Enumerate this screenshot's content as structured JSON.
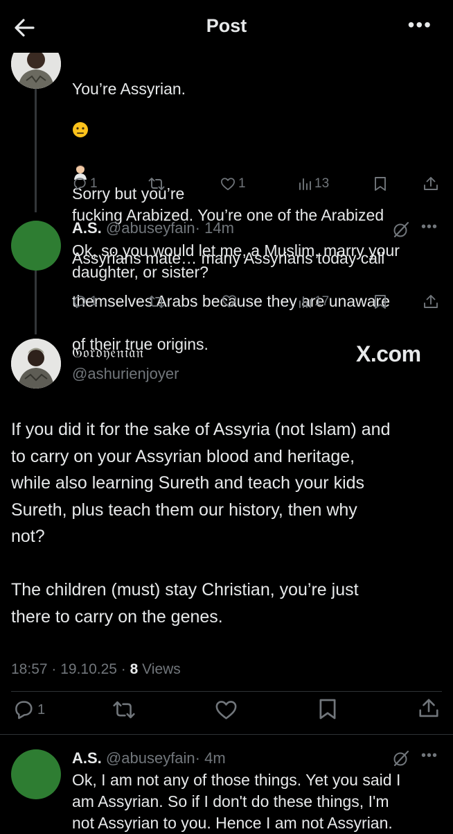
{
  "header": {
    "title": "Post",
    "more_label": "•••"
  },
  "thread": [
    {
      "text_lines": [
        "You’re Assyrian.",
        "Sorry but you’re",
        "fucking Arabized. You’re one of the Arabized",
        "Assyrians mate… many Assyrians today call",
        "themselves Arabs because they are unaware",
        "of their true origins."
      ],
      "emojis": [
        "neutral-face-emoji",
        "person-facepalming-emoji"
      ],
      "stats": {
        "replies": "1",
        "reposts": "",
        "likes": "1",
        "views": "13"
      }
    },
    {
      "name": "A.S.",
      "handle": "@abuseyfain",
      "time": "· 14m",
      "text": "Ok, so you would let me, a Muslim, marry your\ndaughter, or sister?",
      "stats": {
        "replies": "1",
        "reposts": "",
        "likes": "",
        "views": "17"
      }
    }
  ],
  "main_post": {
    "name": "𝔊𝔬𝔯𝔡𝔶𝔢𝔫𝔦𝔞𝔫",
    "handle": "@ashurienjoyer",
    "watermark": "X.com",
    "text": "If you did it for the sake of Assyria (not Islam) and\nto carry on your Assyrian blood and heritage,\nwhile also learning Sureth and teach your kids\nSureth, plus teach them our history, then why\nnot?\n\nThe children (must) stay Christian, you’re just\nthere to carry on the genes.",
    "time": "18:57 · 19.10.25 · ",
    "views_count": "8",
    "views_label": " Views",
    "stats": {
      "replies": "1"
    }
  },
  "reply": {
    "name": "A.S.",
    "handle": "@abuseyfain",
    "time": "· 4m",
    "text": "Ok, I am not any of those things. Yet you said I\nam Assyrian. So if I don't do these things, I'm\nnot Assyrian to you. Hence I am not Assyrian."
  },
  "colors": {
    "background": "#000000",
    "text": "#e7e9ea",
    "muted": "#71767b",
    "avatar_green": "#2e7d32"
  }
}
